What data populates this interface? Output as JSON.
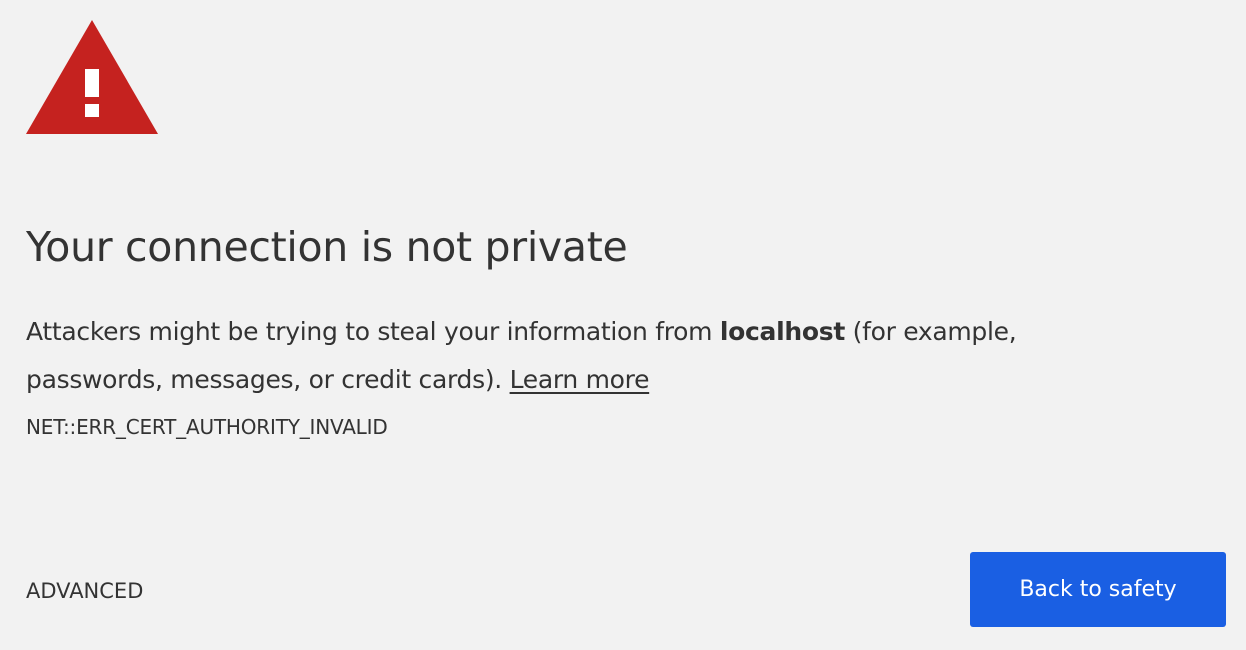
{
  "interstitial": {
    "icon": "warning-triangle-icon",
    "icon_color": "#c5221f",
    "title": "Your connection is not private",
    "explanation_before_host": "Attackers might be trying to steal your information from ",
    "host": "localhost",
    "explanation_after_host": " (for example, passwords, messages, or credit cards). ",
    "learn_more": "Learn more",
    "error_code": "NET::ERR_CERT_AUTHORITY_INVALID"
  },
  "actions": {
    "advanced_label": "ADVANCED",
    "primary_label": "Back to safety",
    "primary_color": "#1a5fe3"
  }
}
